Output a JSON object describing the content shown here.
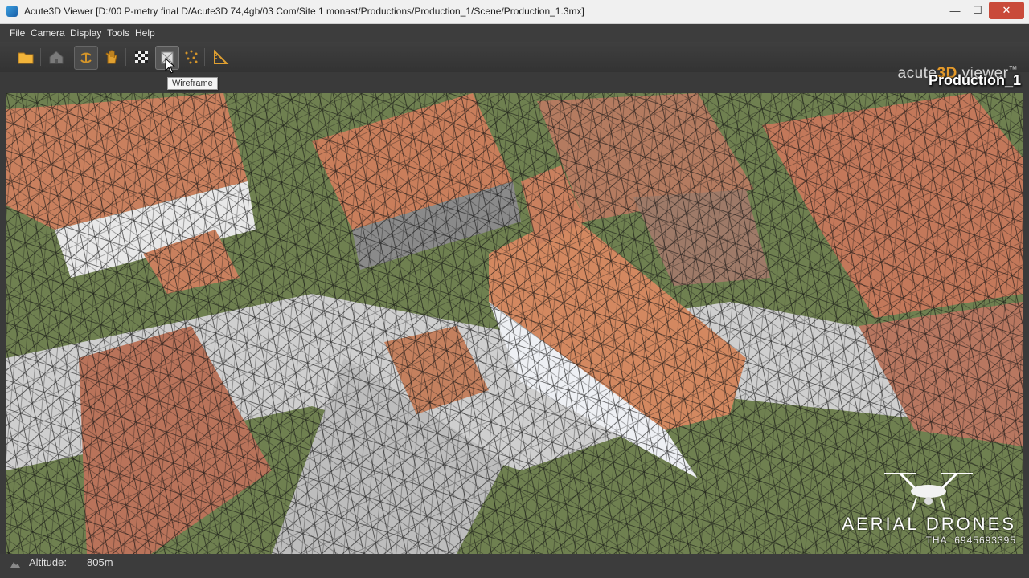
{
  "window": {
    "title": "Acute3D Viewer [D:/00 P-metry final D/Acute3D 74,4gb/03 Com/Site 1 monast/Productions/Production_1/Scene/Production_1.3mx]",
    "minimize": "—",
    "maximize": "☐",
    "close": "✕"
  },
  "menu": {
    "items": [
      "File",
      "Camera",
      "Display",
      "Tools",
      "Help"
    ]
  },
  "toolbar": {
    "buttons": [
      {
        "icon": "open-folder-icon"
      },
      {
        "icon": "home-icon"
      },
      {
        "icon": "orbit-icon"
      },
      {
        "icon": "pan-hand-icon"
      },
      {
        "icon": "texture-icon"
      },
      {
        "icon": "wireframe-icon"
      },
      {
        "icon": "points-icon"
      },
      {
        "icon": "measure-icon"
      }
    ],
    "tooltip": "Wireframe"
  },
  "brand": {
    "prefix": "acute",
    "highlight": "3D",
    "suffix": " viewer",
    "tm": "™"
  },
  "scene": {
    "title": "Production_1"
  },
  "status": {
    "label": "Altitude:",
    "value": "805m"
  },
  "watermark": {
    "name": "AERIAL DRONES",
    "phone": "THA: 6945693395"
  },
  "colors": {
    "roof": "#c9805e",
    "grass": "#5e7a3c",
    "road": "#c8c8c8",
    "wall": "#e8e8e8",
    "accent": "#e59a2a"
  }
}
